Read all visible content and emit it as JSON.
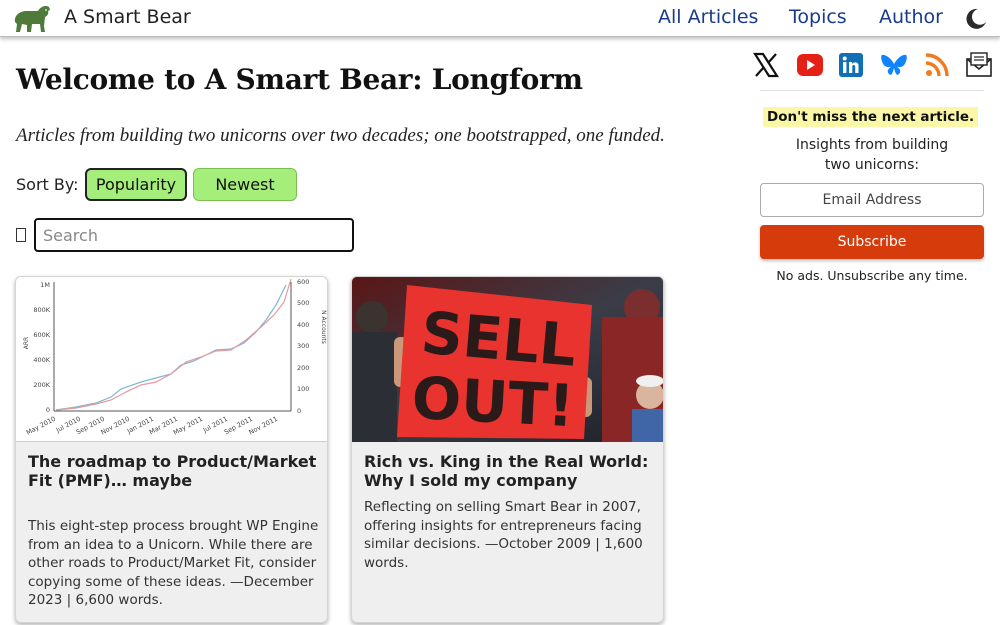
{
  "header": {
    "site_title": "A Smart Bear",
    "nav": [
      "All Articles",
      "Topics",
      "Author"
    ],
    "logo_icon": "bear-logo-icon",
    "theme_toggle_icon": "moon-icon"
  },
  "main": {
    "title": "Welcome to A Smart Bear: Longform",
    "tagline": "Articles from building two unicorns over two decades; one bootstrapped, one funded.",
    "sort": {
      "label": "Sort By:",
      "options": [
        "Popularity",
        "Newest"
      ],
      "selected": "Popularity"
    },
    "search": {
      "placeholder": "Search",
      "value": ""
    }
  },
  "articles": [
    {
      "title": "The roadmap to Product/Market Fit (PMF)… maybe",
      "description": "This eight-step process brought WP Engine from an idea to a Unicorn. While there are other roads to Product/Market Fit, consider copying some of these ideas. —December 2023 | 6,600 words.",
      "thumbnail": {
        "y_left_label": "ARR",
        "y_left_ticks": [
          "1M",
          "800K",
          "600K",
          "400K",
          "200K",
          "0"
        ],
        "y_right_label": "N Accounts",
        "y_right_ticks": [
          "600",
          "500",
          "400",
          "300",
          "200",
          "100",
          "0"
        ],
        "x_ticks": [
          "May 2010",
          "Jul 2010",
          "Sep 2010",
          "Nov 2010",
          "Jan 2011",
          "Mar 2011",
          "May 2011",
          "Jul 2011",
          "Sep 2011",
          "Nov 2011"
        ]
      }
    },
    {
      "title": "Rich vs. King in the Real World: Why I sold my company",
      "description": "Reflecting on selling Smart Bear in 2007, offering insights for entrepreneurs facing similar decisions. —October 2009 | 1,600 words.",
      "thumbnail": {
        "sign_text": [
          "SELL",
          "OUT!"
        ]
      }
    }
  ],
  "sidebar": {
    "social_icons": [
      "x-icon",
      "youtube-icon",
      "linkedin-icon",
      "bluesky-icon",
      "rss-icon",
      "email-icon"
    ],
    "promo": "Don't miss the next article.",
    "insight": "Insights from building two unicorns:",
    "email_placeholder": "Email Address",
    "subscribe_label": "Subscribe",
    "footnote": "No ads. Unsubscribe any time."
  },
  "colors": {
    "nav_link": "#1a3b8c",
    "sort_button": "#a6ee7c",
    "subscribe": "#d63b0c",
    "promo_highlight": "#fbf7a8"
  }
}
